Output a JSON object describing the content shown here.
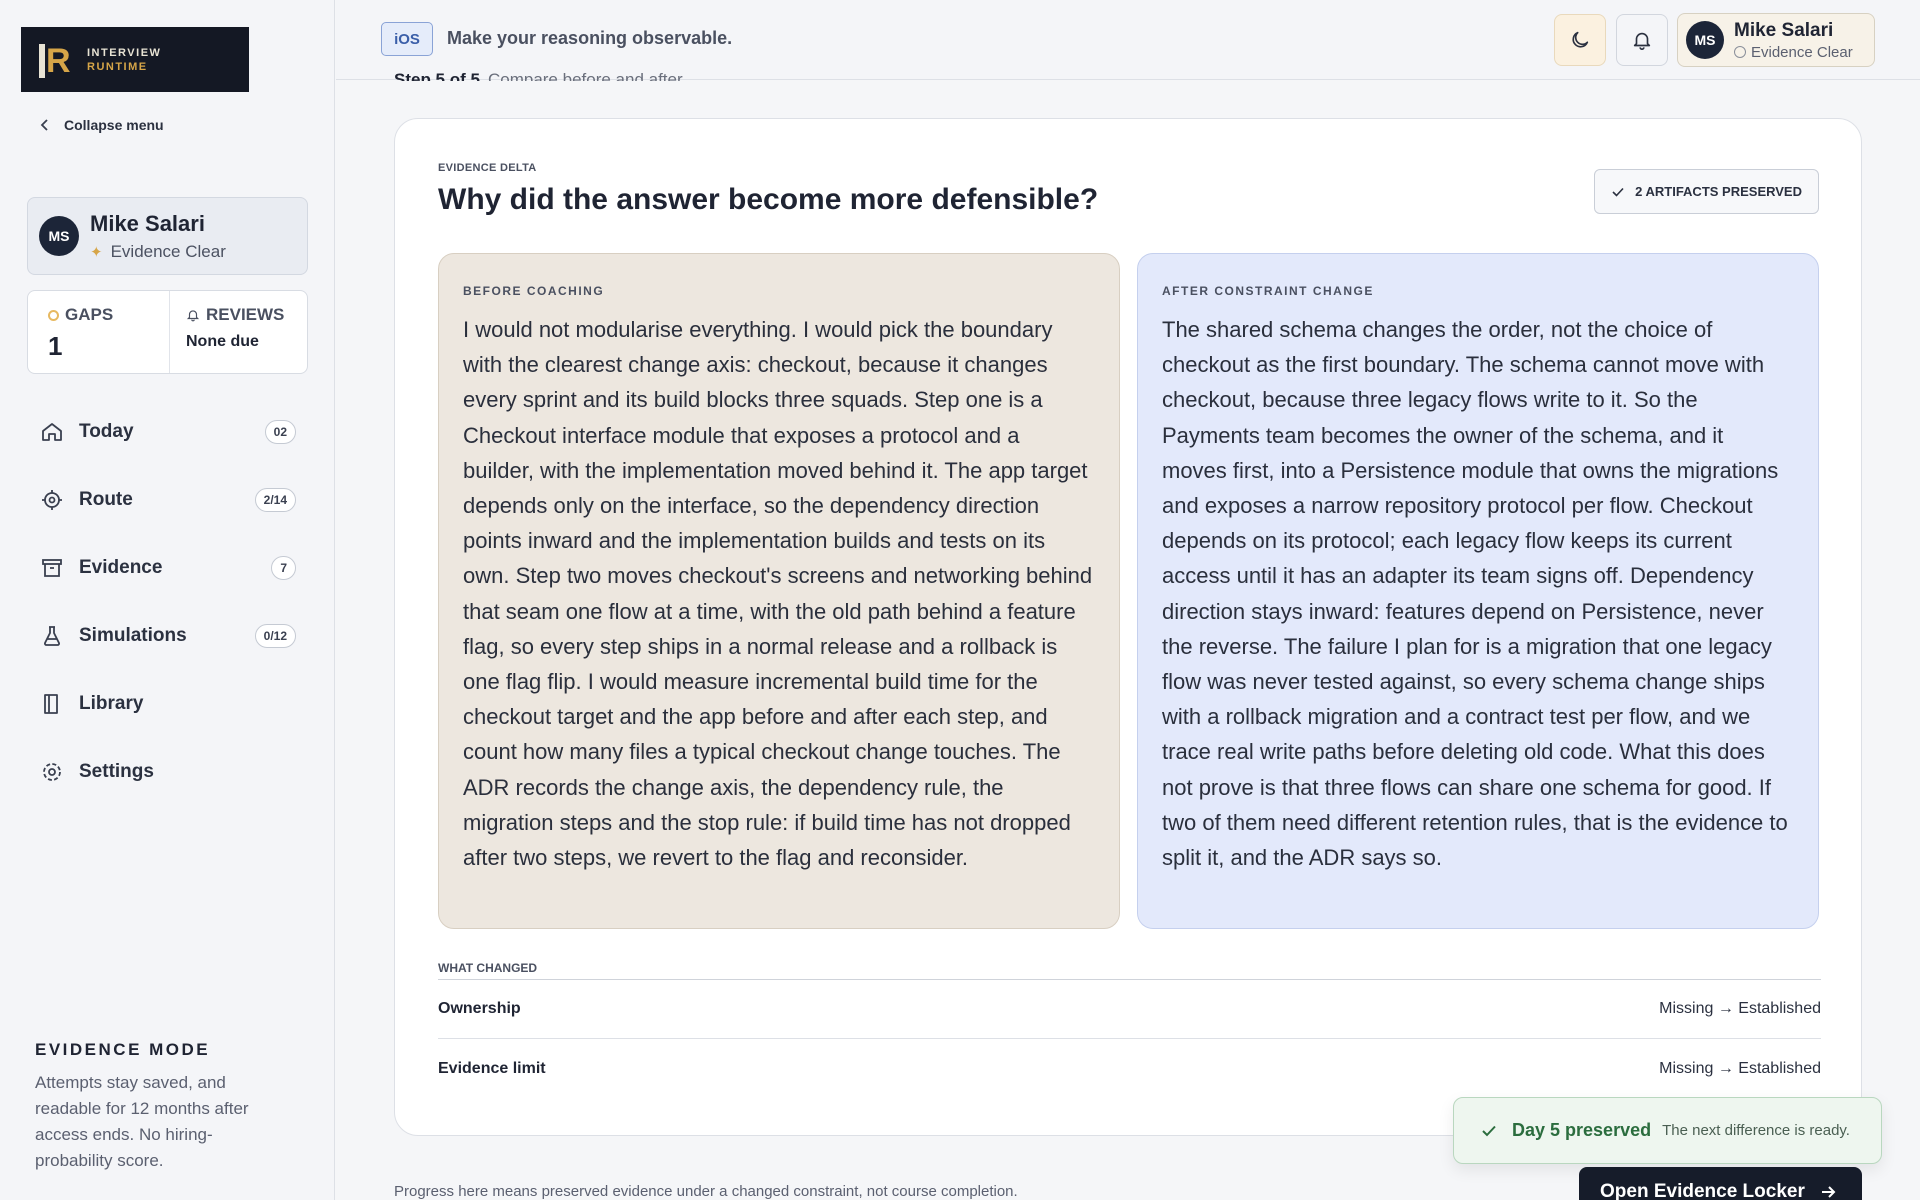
{
  "brand": {
    "line1": "INTERVIEW",
    "line2": "RUNTIME"
  },
  "sidebar": {
    "collapse_label": "Collapse menu",
    "user": {
      "initials": "MS",
      "name": "Mike Salari",
      "status": "Evidence Clear"
    },
    "stats": {
      "gaps_label": "GAPS",
      "gaps_value": "1",
      "reviews_label": "REVIEWS",
      "reviews_value": "None due"
    },
    "items": [
      {
        "label": "Today",
        "badge": "02",
        "icon": "home-icon"
      },
      {
        "label": "Route",
        "badge": "2/14",
        "icon": "target-icon"
      },
      {
        "label": "Evidence",
        "badge": "7",
        "icon": "archive-icon"
      },
      {
        "label": "Simulations",
        "badge": "0/12",
        "icon": "flask-icon"
      },
      {
        "label": "Library",
        "icon": "book-icon"
      },
      {
        "label": "Settings",
        "icon": "gear-icon"
      }
    ],
    "mode": {
      "title": "EVIDENCE MODE",
      "description": "Attempts stay saved, and readable for 12 months after access ends. No hiring-probability score."
    }
  },
  "topbar": {
    "platform_chip": "iOS",
    "tagline": "Make your reasoning observable.",
    "user": {
      "initials": "MS",
      "name": "Mike Salari",
      "status": "Evidence Clear"
    }
  },
  "main": {
    "step_label": "Step 5 of 5",
    "step_sub": "Compare before and after",
    "eyebrow": "EVIDENCE DELTA",
    "title": "Why did the answer become more defensible?",
    "preserved_badge": "2 ARTIFACTS PRESERVED",
    "before": {
      "title": "BEFORE COACHING",
      "text": "I would not modularise everything. I would pick the boundary with the clearest change axis: checkout, because it changes every sprint and its build blocks three squads. Step one is a Checkout interface module that exposes a protocol and a builder, with the implementation moved behind it. The app target depends only on the interface, so the dependency direction points inward and the implementation builds and tests on its own. Step two moves checkout's screens and networking behind that seam one flow at a time, with the old path behind a feature flag, so every step ships in a normal release and a rollback is one flag flip. I would measure incremental build time for the checkout target and the app before and after each step, and count how many files a typical checkout change touches. The ADR records the change axis, the dependency rule, the migration steps and the stop rule: if build time has not dropped after two steps, we revert to the flag and reconsider."
    },
    "after": {
      "title": "AFTER CONSTRAINT CHANGE",
      "text": "The shared schema changes the order, not the choice of checkout as the first boundary. The schema cannot move with checkout, because three legacy flows write to it. So the Payments team becomes the owner of the schema, and it moves first, into a Persistence module that owns the migrations and exposes a narrow repository protocol per flow. Checkout depends on its protocol; each legacy flow keeps its current access until it has an adapter its team signs off. Dependency direction stays inward: features depend on Persistence, never the reverse. The failure I plan for is a migration that one legacy flow was never tested against, so every schema change ships with a rollback migration and a contract test per flow, and we trace real write paths before deleting old code. What this does not prove is that three flows can share one schema for good. If two of them need different retention rules, that is the evidence to split it, and the ADR says so."
    },
    "what_changed": {
      "title": "WHAT CHANGED",
      "rows": [
        {
          "label": "Ownership",
          "value": "Missing → Established"
        },
        {
          "label": "Evidence limit",
          "value": "Missing → Established"
        }
      ]
    },
    "footnote": "Progress here means preserved evidence under a changed constraint, not course completion.",
    "open_button": "Open Evidence Locker"
  },
  "toast": {
    "title": "Day 5 preserved",
    "subtitle": "The next difference is ready."
  }
}
